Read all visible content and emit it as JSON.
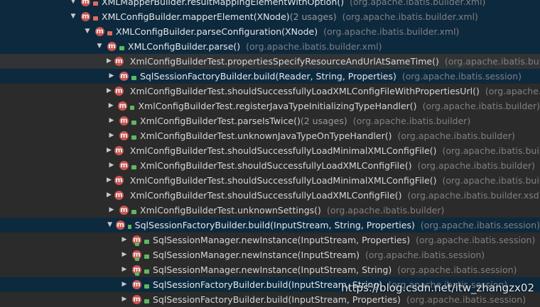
{
  "rows": [
    {
      "name": "XMLMapperBuilder.resultMappingElementWithOption()",
      "usage": "",
      "pkg": "(org.apache.ibatis.builder.xml)"
    },
    {
      "name": "XMLConfigBuilder.mapperElement(XNode)",
      "usage": "(2 usages)",
      "pkg": "(org.apache.ibatis.builder.xml)"
    },
    {
      "name": "XMLConfigBuilder.parseConfiguration(XNode)",
      "usage": "",
      "pkg": "(org.apache.ibatis.builder.xml)"
    },
    {
      "name": "XMLConfigBuilder.parse()",
      "usage": "",
      "pkg": "(org.apache.ibatis.builder.xml)"
    },
    {
      "name": "XmlConfigBuilderTest.propertiesSpecifyResourceAndUrlAtSameTime()",
      "usage": "",
      "pkg": "(org.apache.ibatis.builde"
    },
    {
      "name": "SqlSessionFactoryBuilder.build(Reader, String, Properties)",
      "usage": "",
      "pkg": "(org.apache.ibatis.session)"
    },
    {
      "name": "XmlConfigBuilderTest.shouldSuccessfullyLoadXMLConfigFileWithPropertiesUrl()",
      "usage": "",
      "pkg": "(org.apache.iba"
    },
    {
      "name": "XmlConfigBuilderTest.registerJavaTypeInitializingTypeHandler()",
      "usage": "",
      "pkg": "(org.apache.ibatis.builder)"
    },
    {
      "name": "XmlConfigBuilderTest.parseIsTwice()",
      "usage": "(2 usages)",
      "pkg": "(org.apache.ibatis.builder)"
    },
    {
      "name": "XmlConfigBuilderTest.unknownJavaTypeOnTypeHandler()",
      "usage": "",
      "pkg": "(org.apache.ibatis.builder)"
    },
    {
      "name": "XmlConfigBuilderTest.shouldSuccessfullyLoadMinimalXMLConfigFile()",
      "usage": "",
      "pkg": "(org.apache.ibatis.builder"
    },
    {
      "name": "XmlConfigBuilderTest.shouldSuccessfullyLoadXMLConfigFile()",
      "usage": "",
      "pkg": "(org.apache.ibatis.builder)"
    },
    {
      "name": "XmlConfigBuilderTest.shouldSuccessfullyLoadMinimalXMLConfigFile()",
      "usage": "",
      "pkg": "(org.apache.ibatis.builder"
    },
    {
      "name": "XmlConfigBuilderTest.shouldSuccessfullyLoadXMLConfigFile()",
      "usage": "",
      "pkg": "(org.apache.ibatis.builder.xsd)"
    },
    {
      "name": "XmlConfigBuilderTest.unknownSettings()",
      "usage": "",
      "pkg": "(org.apache.ibatis.builder)"
    },
    {
      "name": "SqlSessionFactoryBuilder.build(InputStream, String, Properties)",
      "usage": "",
      "pkg": "(org.apache.ibatis.session)"
    },
    {
      "name": "SqlSessionManager.newInstance(InputStream, Properties)",
      "usage": "",
      "pkg": "(org.apache.ibatis.session)"
    },
    {
      "name": "SqlSessionManager.newInstance(InputStream)",
      "usage": "",
      "pkg": "(org.apache.ibatis.session)"
    },
    {
      "name": "SqlSessionManager.newInstance(InputStream, String)",
      "usage": "",
      "pkg": "(org.apache.ibatis.session)"
    },
    {
      "name": "SqlSessionFactoryBuilder.build(InputStream, String)",
      "usage": "",
      "pkg": "(org.apache.ibatis.session)"
    },
    {
      "name": "SqlSessionFactoryBuilder.build(InputStream, Properties)",
      "usage": "",
      "pkg": "(org.apache.ibatis.session)"
    }
  ],
  "watermark": "https://blog.csdn.net/itw_zhangzx02",
  "colors": {
    "background": "#2b2b2b",
    "selected": "#0d293e",
    "method_icon": "#c75450"
  },
  "icons": {
    "expanded": "triangle-down",
    "collapsed": "triangle-right",
    "method": "method-m-icon"
  }
}
